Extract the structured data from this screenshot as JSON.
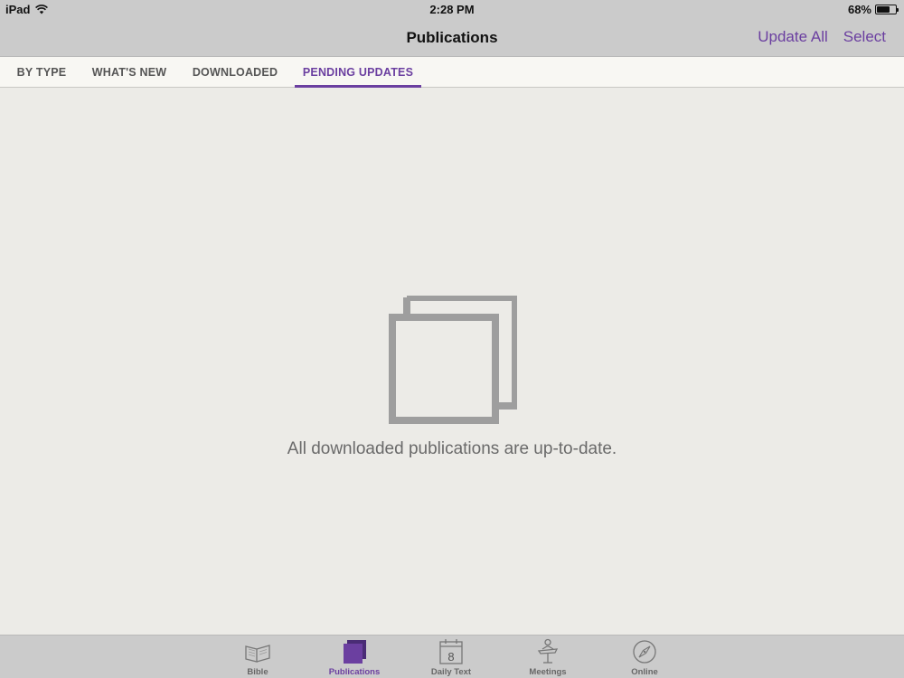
{
  "status_bar": {
    "device": "iPad",
    "time": "2:28 PM",
    "battery_percent_label": "68%",
    "battery_level": 0.68
  },
  "nav": {
    "title": "Publications",
    "update_all_label": "Update All",
    "select_label": "Select"
  },
  "tabs": [
    {
      "label": "BY TYPE",
      "active": false
    },
    {
      "label": "WHAT'S NEW",
      "active": false
    },
    {
      "label": "DOWNLOADED",
      "active": false
    },
    {
      "label": "PENDING UPDATES",
      "active": true
    }
  ],
  "empty_state": {
    "message": "All downloaded publications are up-to-date.",
    "icon": "stacked-squares-icon"
  },
  "tab_bar": {
    "items": [
      {
        "label": "Bible",
        "icon": "open-book-icon",
        "active": false
      },
      {
        "label": "Publications",
        "icon": "publications-icon",
        "active": true
      },
      {
        "label": "Daily Text",
        "icon": "calendar-icon",
        "calendar_day": "8",
        "active": false
      },
      {
        "label": "Meetings",
        "icon": "lectern-icon",
        "active": false
      },
      {
        "label": "Online",
        "icon": "compass-icon",
        "active": false
      }
    ]
  },
  "colors": {
    "accent": "#6b3fa0",
    "bar_background": "#cbcbcb",
    "content_background": "#ecebe7",
    "icon_gray": "#9e9e9e"
  }
}
